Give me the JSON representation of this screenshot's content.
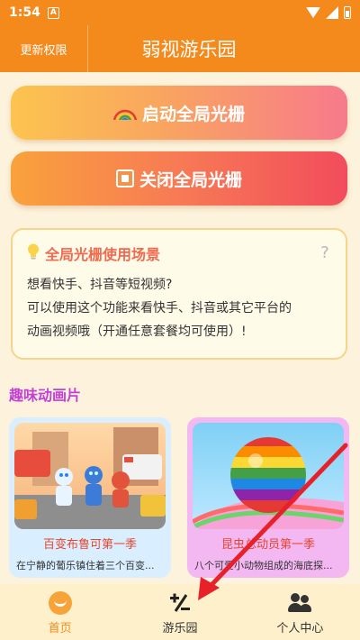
{
  "status_bar": {
    "time": "1:54",
    "notif_letter": "A"
  },
  "header": {
    "update_label": "更新权限",
    "title": "弱视游乐园"
  },
  "buttons": {
    "start_label": "启动全局光栅",
    "stop_label": "关闭全局光栅"
  },
  "info": {
    "title": "全局光栅使用场景",
    "line1": "想看快手、抖音等短视频?",
    "line2": "可以使用这个功能来看快手、抖音或其它平台的",
    "line3": "动画视频哦（开通任意套餐均可使用）!"
  },
  "section": {
    "title": "趣味动画片"
  },
  "cards": [
    {
      "title": "百变布鲁可第一季",
      "desc": "在宁静的葡乐镇住着三个百变..."
    },
    {
      "title": "昆虫总动员第一季",
      "desc": "八个可爱小动物组成的海底探..."
    }
  ],
  "tabs": [
    {
      "label": "首页",
      "active": true
    },
    {
      "label": "游乐园",
      "active": false
    },
    {
      "label": "个人中心",
      "active": false
    }
  ],
  "colors": {
    "brand": "#f38a1b",
    "section_title": "#c43fd6",
    "annotation": "#e8202a"
  }
}
